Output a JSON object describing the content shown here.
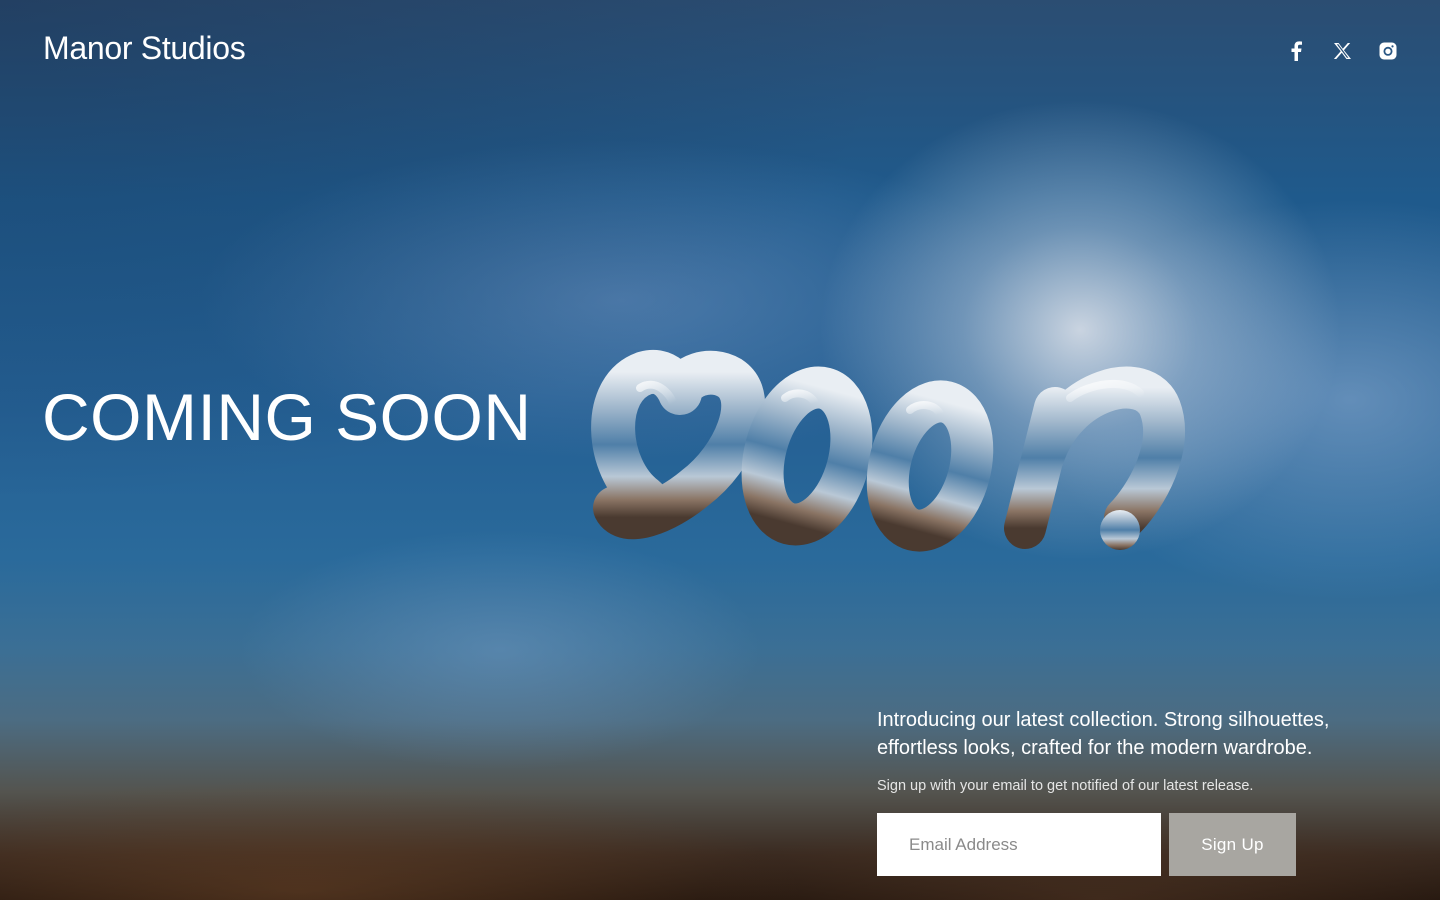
{
  "header": {
    "brand": "Manor Studios",
    "social": [
      {
        "icon": "facebook-icon",
        "label": "Facebook"
      },
      {
        "icon": "x-twitter-icon",
        "label": "X"
      },
      {
        "icon": "instagram-icon",
        "label": "Instagram"
      }
    ]
  },
  "hero": {
    "headline": "COMING SOON",
    "artwork_text": "soon"
  },
  "signup": {
    "intro": "Introducing our latest collection. Strong silhouettes, effortless looks, crafted for the modern wardrobe.",
    "note": "Sign up with your email to get notified of our latest release.",
    "email_placeholder": "Email Address",
    "button_label": "Sign Up"
  },
  "colors": {
    "button_bg": "#a8a6a1",
    "text": "#ffffff"
  }
}
